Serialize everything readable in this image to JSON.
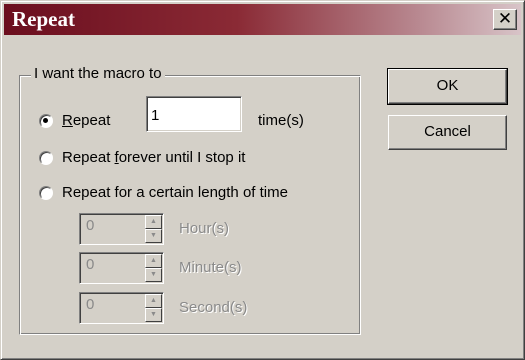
{
  "window": {
    "title": "Repeat",
    "close_glyph": "✕"
  },
  "group": {
    "label": "I want the macro to"
  },
  "options": {
    "repeat": {
      "label_u": "R",
      "label_rest": "epeat",
      "selected": true
    },
    "forever": {
      "label_a": "Repeat ",
      "label_u": "f",
      "label_b": "orever until I stop it",
      "selected": false
    },
    "length": {
      "label": "Repeat for a certain length of time",
      "selected": false
    }
  },
  "times_input": {
    "value": "1",
    "suffix": "time(s)"
  },
  "duration": [
    {
      "value": "0",
      "unit": "Hour(s)"
    },
    {
      "value": "0",
      "unit": "Minute(s)"
    },
    {
      "value": "0",
      "unit": "Second(s)"
    }
  ],
  "buttons": {
    "ok": "OK",
    "cancel": "Cancel"
  },
  "colors": {
    "title_start": "#6b0e1e",
    "face": "#d4d0c8",
    "disabled_text": "#8a8a8a"
  }
}
